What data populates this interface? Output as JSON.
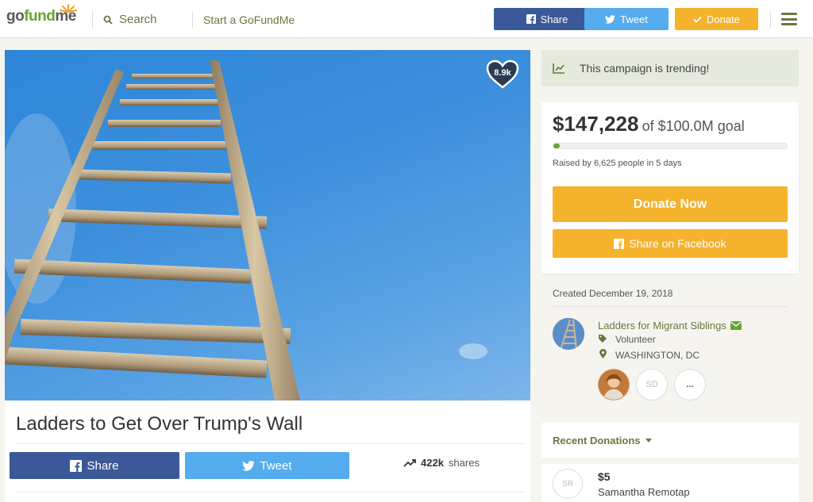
{
  "header": {
    "logo": {
      "go": "go",
      "fund": "fund",
      "me": "me"
    },
    "search_label": "Search",
    "start_label": "Start a GoFundMe",
    "share_label": "Share",
    "tweet_label": "Tweet",
    "donate_label": "Donate"
  },
  "hero": {
    "hearts": "8.9k"
  },
  "campaign": {
    "title": "Ladders to Get Over Trump's Wall",
    "share_label": "Share",
    "tweet_label": "Tweet",
    "shares_count": "422k",
    "shares_label": "shares"
  },
  "sidebar": {
    "trending_text": "This campaign is trending!",
    "raised_amount": "$147,228",
    "goal_text": "of $100.0M goal",
    "progress_fraction": 0.0015,
    "raised_by": "Raised by 6,625 people in 5 days",
    "donate_now_label": "Donate Now",
    "share_fb_label": "Share on Facebook",
    "created": "Created December 19, 2018",
    "organizer": {
      "name": "Ladders for Migrant Siblings",
      "role": "Volunteer",
      "location": "WASHINGTON, DC"
    },
    "team": {
      "initials": "SD",
      "more": "..."
    },
    "recent_donations_label": "Recent Donations",
    "donation": {
      "initials": "SR",
      "amount": "$5",
      "name": "Samantha Remotap"
    }
  },
  "colors": {
    "brand_green": "#68a331",
    "facebook": "#3b5998",
    "twitter": "#55acee",
    "donate": "#f4b22d"
  }
}
